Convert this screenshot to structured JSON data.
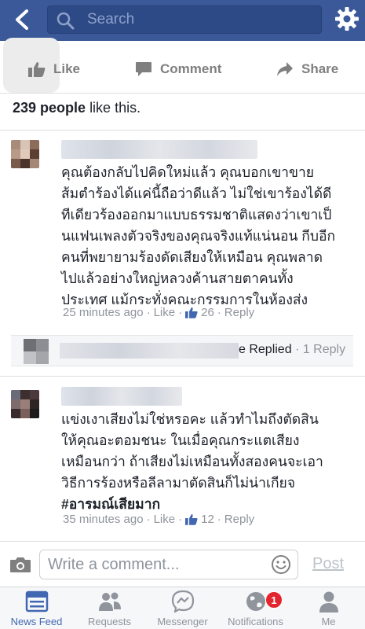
{
  "header": {
    "search_placeholder": "Search",
    "bar_color": "#3b5998"
  },
  "actions": {
    "like": "Like",
    "comment": "Comment",
    "share": "Share"
  },
  "likes_summary": {
    "count": "239 people",
    "suffix": "like this."
  },
  "comments": [
    {
      "lines": [
        "คุณต้องกลับไปคิดใหม่แล้ว คุณบอกเขาขาย",
        "ส้มตำร้องได้แค่นี้ถือว่าดีแล้ว ไม่ใช่เขาร้องได้ดี",
        "ทีเดียวร้องออกมาแบบธรรมชาติแสดงว่าเขาเป็",
        "นแฟนเพลงตัวจริงของคุณจริงแท้แน่นอน กีบอีก",
        "คนที่พยายามร้องดัดเสียงให้เหมือน คุณพลาด",
        "ไปแล้วอย่างใหญ่หลวงค้านสายตาคนทั้ง",
        "ประเทศ แม้กระทั่งคณะกรรมการในห้องส่ง"
      ],
      "time": "25 minutes ago",
      "like_label": "Like",
      "likes": "26",
      "reply_label": "Reply"
    },
    {
      "lines": [
        "แข่งเงาเสียงไม่ใช่หรอคะ แล้วทำไมถึงตัดสิน",
        "ให้คุณอะตอมชนะ ในเมื่อคุณกระแตเสียง",
        "เหมือนกว่า ถ้าเสียงไม่เหมือนทั้งสองคนจะเอา",
        "วิธีการร้องหรือลีลามาตัดสินก็ไม่น่าเกียจ"
      ],
      "hashtag": "#อารมณ์เสียมาก",
      "time": "35 minutes ago",
      "like_label": "Like",
      "likes": "12",
      "reply_label": "Reply"
    }
  ],
  "reply_row": {
    "replied_text": "e Replied",
    "count_text": "· 1 Reply"
  },
  "composer": {
    "placeholder": "Write a comment...",
    "post_label": "Post"
  },
  "tabbar": {
    "tabs": [
      {
        "label": "News Feed",
        "icon": "news-feed-icon",
        "active": true
      },
      {
        "label": "Requests",
        "icon": "friend-requests-icon"
      },
      {
        "label": "Messenger",
        "icon": "messenger-icon"
      },
      {
        "label": "Notifications",
        "icon": "globe-icon"
      },
      {
        "label": "Me",
        "icon": "person-icon"
      }
    ],
    "notifications_badge": "1",
    "active_color": "#4267b2"
  }
}
